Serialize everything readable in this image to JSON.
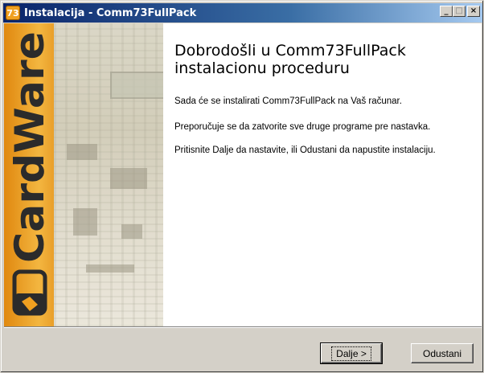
{
  "window": {
    "title": "Instalacija - Comm73FullPack",
    "app_icon_text": "73",
    "controls": {
      "minimize": "_",
      "maximize": "□",
      "close": "×"
    }
  },
  "sidebar": {
    "brand_text": "CardWare",
    "colors": {
      "orange": "#f0a020",
      "orange_dark": "#d9780a",
      "brand_text": "#2b2b2b"
    }
  },
  "main": {
    "heading_line1": "Dobrodošli u Comm73FullPack",
    "heading_line2": "instalacionu proceduru",
    "paragraph1": "Sada će se instalirati Comm73FullPack na Vaš računar.",
    "paragraph2": "Preporučuje se da zatvorite sve druge programe pre nastavka.",
    "paragraph3": "Pritisnite Dalje da nastavite, ili Odustani da napustite instalaciju."
  },
  "buttons": {
    "next_label": "Dalje >",
    "cancel_label": "Odustani"
  }
}
